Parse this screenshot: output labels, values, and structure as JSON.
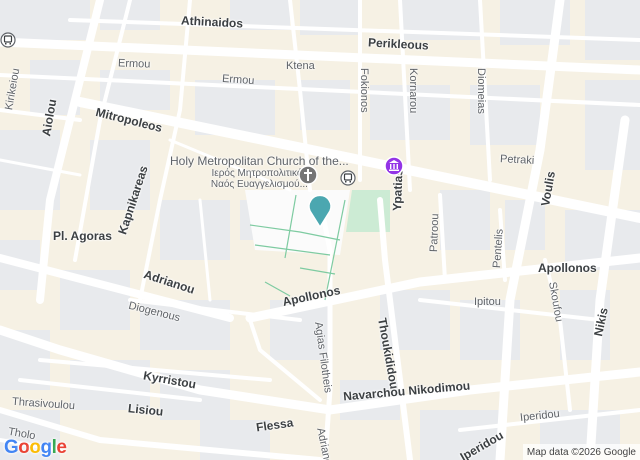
{
  "streets": {
    "athinaidos": "Athinaidos",
    "perikleous": "Perikleous",
    "ermou_west": "Ermou",
    "ermou_east": "Ermou",
    "ktena": "Ktena",
    "fokionos": "Fokionos",
    "kornarou": "Kornarou",
    "diomeias": "Diomeias",
    "kirikeiou": "Kirikeiou",
    "aiolou": "Aiolou",
    "mitropoleos": "Mitropoleos",
    "petraki": "Petraki",
    "voulis": "Voulis",
    "kapnikareas": "Kapnikareas",
    "ypatias": "Ypatias",
    "patroou": "Patroou",
    "pentelis": "Pentelis",
    "pl_agoras": "Pl. Agoras",
    "apollonos_east": "Apollonos",
    "apollonos_mid": "Apollonos",
    "adrianou": "Adrianou",
    "diogenous": "Diogenous",
    "skoufou": "Skoufou",
    "nikis": "Nikis",
    "ipitou": "Ipitou",
    "thoukididou": "Thoukididou",
    "agias_filotheis": "Agias Filotheis",
    "kyrristou": "Kyrristou",
    "thrasivoulou": "Thrasivoulou",
    "lisiou": "Lisiou",
    "navarchou": "Navarchou Nikodimou",
    "flessa": "Flessa",
    "adriano_bottom": "Adriano",
    "iperidou_a": "Iperidou",
    "iperidou_b": "Iperidou",
    "tholou": "Tholo"
  },
  "poi": {
    "church_en": "Holy Metropolitan Church of the...",
    "church_gr_1": "Ιερός Μητροπολιτικός",
    "church_gr_2": "Ναός Ευαγγελισμού..."
  },
  "icons": {
    "church": "church-cross-icon",
    "museum": "museum-icon",
    "transit": "transit-bus-icon",
    "pin": "location-pin-icon"
  },
  "colors": {
    "block": "#e8eaed",
    "background": "#f6f1e4",
    "road": "#ffffff",
    "park": "#ccebd4",
    "museum": "#9334e6",
    "pin": "#4ba7b0",
    "poi_gray": "#757575",
    "footpath": "#7ecba1"
  },
  "attribution": {
    "logo": "Google",
    "map_data": "Map data ©2026 Google"
  }
}
